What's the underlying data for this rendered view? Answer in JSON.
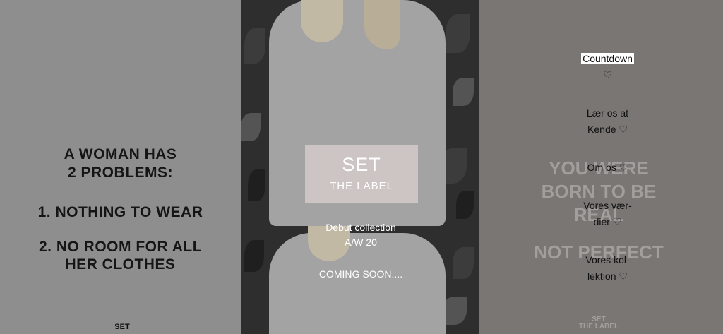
{
  "left": {
    "quote_lines": [
      "A WOMAN HAS",
      "2 PROBLEMS:",
      "1. NOTHING TO WEAR",
      "2. NO ROOM FOR ALL",
      "HER CLOTHES"
    ],
    "logo": "SET"
  },
  "center": {
    "logo_set": "SET",
    "logo_label": "THE LABEL",
    "caption_line1": "Debut collection",
    "caption_line2": "A/W 20",
    "coming_soon": "COMING SOON...."
  },
  "right": {
    "watermark_lines": [
      "YOU WERE",
      "BORN TO BE",
      "REAL",
      "NOT PERFECT"
    ],
    "watermark_logo": "SET\nTHE LABEL",
    "nav": [
      {
        "line1": "Countdown",
        "line2": "♡"
      },
      {
        "line1": "Lær os at",
        "line2": "Kende ♡"
      },
      {
        "line1": "Om os ♡",
        "line2": ""
      },
      {
        "line1": "Vores vær-",
        "line2": "dier ♡"
      },
      {
        "line1": "Vores kol-",
        "line2": "lektion ♡"
      }
    ]
  }
}
